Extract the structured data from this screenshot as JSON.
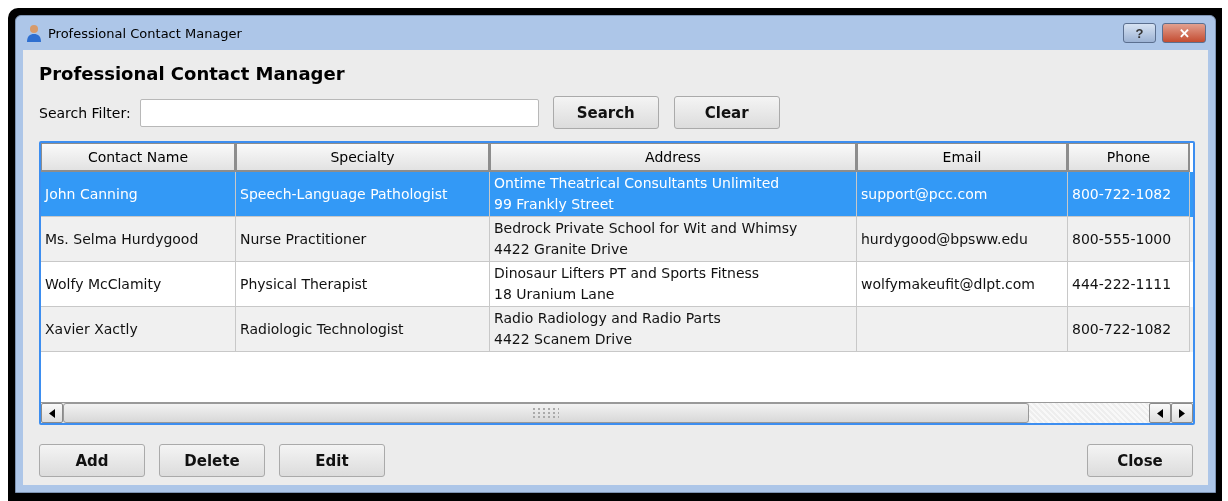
{
  "window": {
    "title": "Professional Contact Manager",
    "controls": [
      "?",
      "✕"
    ]
  },
  "heading": "Professional Contact Manager",
  "search": {
    "label": "Search Filter:",
    "buttons": [
      "Search",
      "Clear"
    ]
  },
  "table": {
    "columns": [
      "Contact Name",
      "Specialty",
      "Address",
      "Email",
      "Phone"
    ],
    "rows": [
      {
        "selected": true,
        "cells": [
          "John Canning",
          "Speech-Language Pathologist",
          [
            "Ontime Theatrical Consultants Unlimited",
            "99 Frankly Street"
          ],
          "support@pcc.com",
          "800-722-1082"
        ]
      },
      {
        "selected": false,
        "cells": [
          "Ms. Selma Hurdygood",
          "Nurse Practitioner",
          [
            "Bedrock Private School for Wit and Whimsy",
            "4422 Granite Drive"
          ],
          "hurdygood@bpsww.edu",
          "800-555-1000"
        ]
      },
      {
        "selected": false,
        "cells": [
          "Wolfy McClamity",
          "Physical Therapist",
          [
            "Dinosaur Lifters PT and Sports Fitness",
            "18 Uranium Lane"
          ],
          "wolfymakeufit@dlpt.com",
          "444-222-1111"
        ]
      },
      {
        "selected": false,
        "cells": [
          "Xavier Xactly",
          "Radiologic Technologist",
          [
            "Radio Radiology and Radio Parts",
            "4422 Scanem Drive"
          ],
          "",
          "800-722-1082"
        ]
      }
    ]
  },
  "actions": [
    "Add",
    "Delete",
    "Edit"
  ],
  "close": "Close"
}
